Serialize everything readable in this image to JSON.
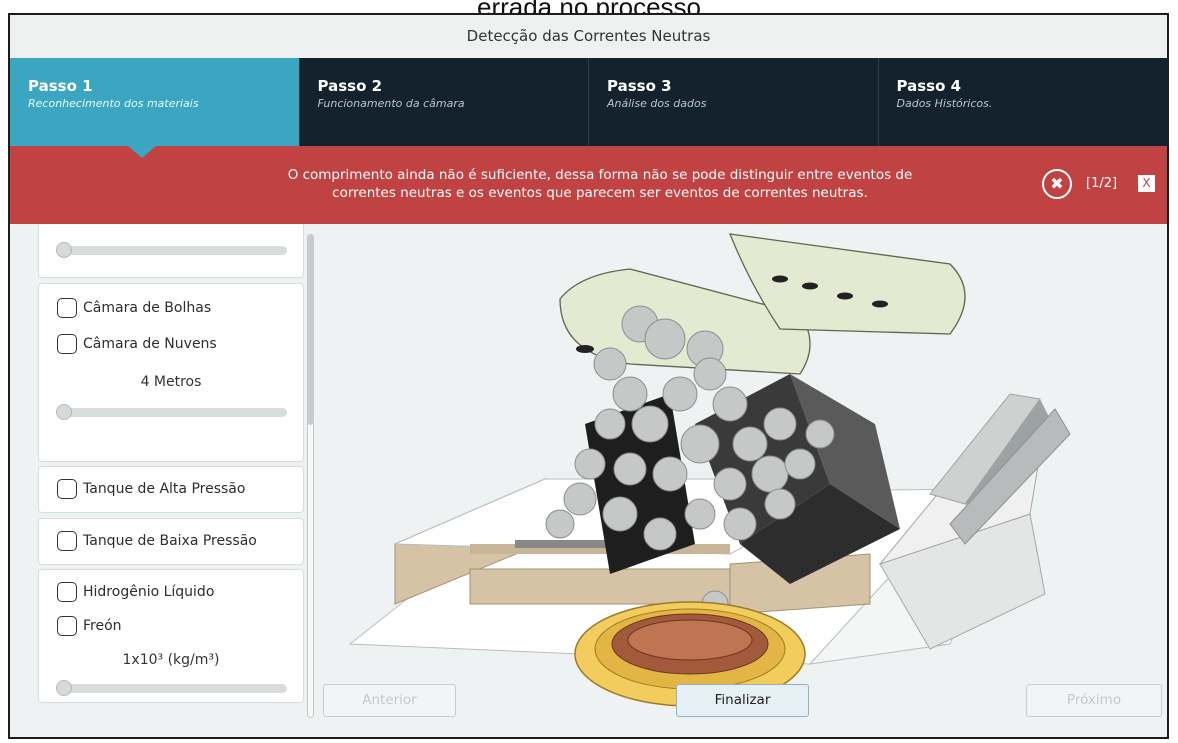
{
  "caption": "errada no processo",
  "app_title": "Detecção das Correntes Neutras",
  "steps": [
    {
      "number": "Passo 1",
      "subtitle": "Reconhecimento dos materiais"
    },
    {
      "number": "Passo 2",
      "subtitle": "Funcionamento da câmara"
    },
    {
      "number": "Passo 3",
      "subtitle": "Análise dos dados"
    },
    {
      "number": "Passo 4",
      "subtitle": "Dados Históricos."
    }
  ],
  "alert": {
    "line1": "O comprimento ainda não é suficiente, dessa forma não se pode distinguir entre eventos de",
    "line2": "correntes neutras e os eventos que parecem ser eventos de correntes neutras.",
    "counter": "[1/2]",
    "close_glyph": "✖",
    "dismiss_glyph": "X",
    "color": "#c14243"
  },
  "panel": {
    "chamber": {
      "options": [
        "Câmara de Bolhas",
        "Câmara de Nuvens"
      ],
      "value": "4 Metros"
    },
    "tanks": [
      "Tanque de Alta Pressão",
      "Tanque de Baixa Pressão"
    ],
    "liquid": {
      "options": [
        "Hidrogênio Líquido",
        "Freón"
      ],
      "value": "1x10³ (kg/m³)"
    }
  },
  "nav": {
    "prev": "Anterior",
    "finish": "Finalizar",
    "next": "Próximo"
  },
  "colors": {
    "active_step": "#3aa6c2",
    "steps_bg": "#13222c"
  }
}
